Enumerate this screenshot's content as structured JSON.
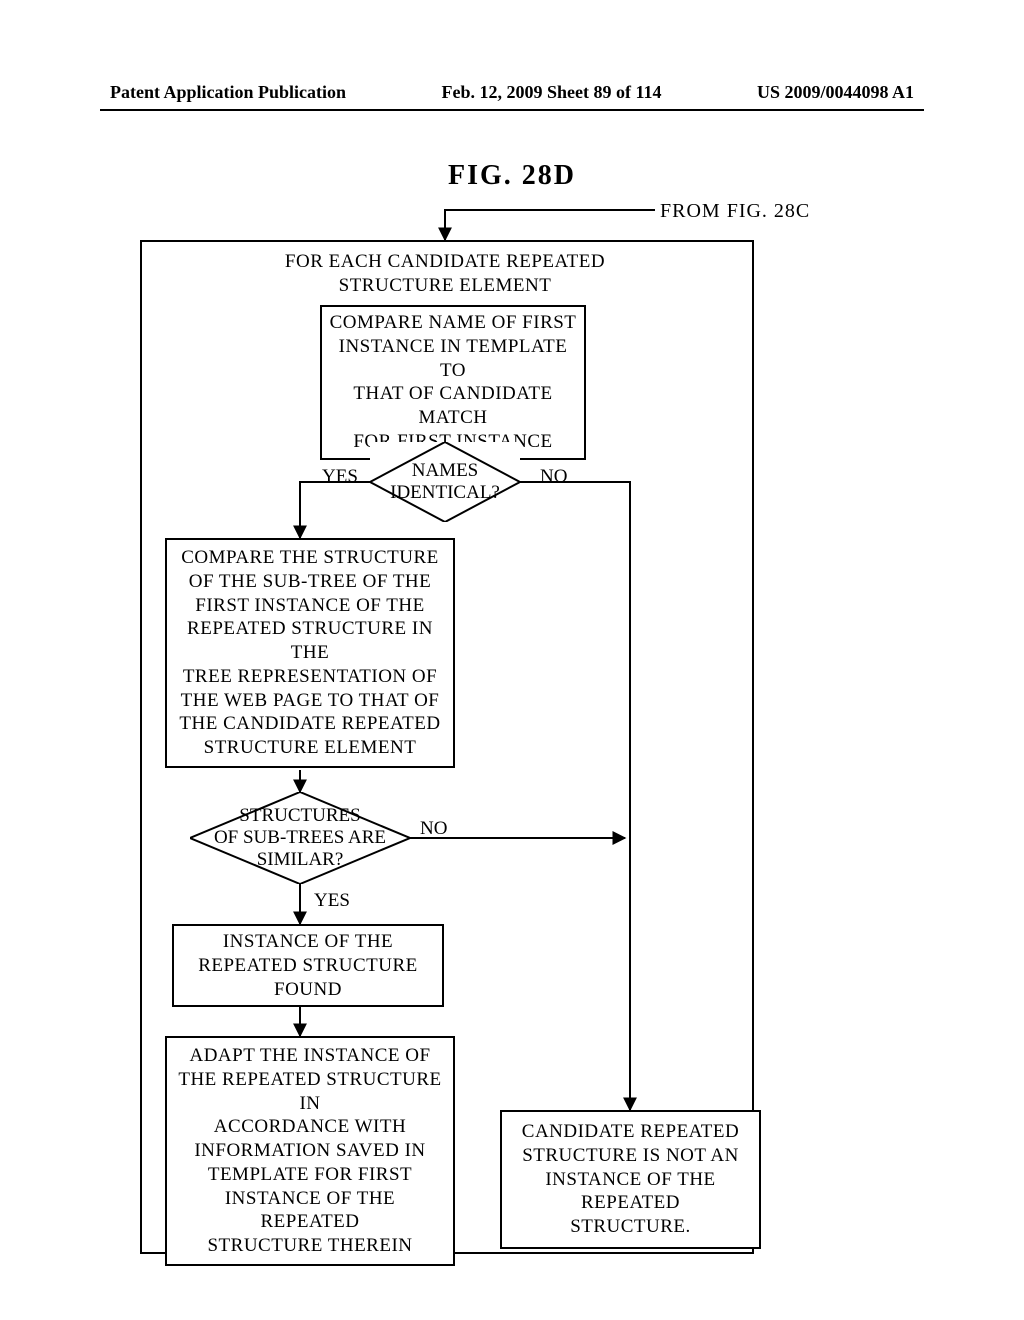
{
  "header": {
    "left": "Patent Application Publication",
    "center": "Feb. 12, 2009  Sheet 89 of 114",
    "right": "US 2009/0044098 A1"
  },
  "fig_title": "FIG. 28D",
  "from_label": "FROM FIG. 28C",
  "loop_header": "FOR EACH CANDIDATE REPEATED\nSTRUCTURE ELEMENT",
  "box_compare_name": "COMPARE NAME OF FIRST\nINSTANCE IN TEMPLATE TO\nTHAT OF CANDIDATE MATCH\nFOR FIRST INSTANCE",
  "diamond_names": "NAMES\nIDENTICAL?",
  "yes1": "YES",
  "no1": "NO",
  "box_compare_struct": "COMPARE THE STRUCTURE\nOF THE SUB-TREE OF THE\nFIRST INSTANCE OF THE\nREPEATED STRUCTURE IN THE\nTREE REPRESENTATION OF\nTHE WEB PAGE TO THAT OF\nTHE CANDIDATE REPEATED\nSTRUCTURE ELEMENT",
  "diamond_struct": "STRUCTURES\nOF SUB-TREES ARE\nSIMILAR?",
  "no2": "NO",
  "yes2": "YES",
  "box_found": "INSTANCE OF THE\nREPEATED STRUCTURE FOUND",
  "box_adapt": "ADAPT THE INSTANCE OF\nTHE REPEATED STRUCTURE IN\nACCORDANCE WITH\nINFORMATION SAVED IN\nTEMPLATE FOR FIRST\nINSTANCE OF THE REPEATED\nSTRUCTURE THEREIN",
  "box_notinstance": "CANDIDATE REPEATED\nSTRUCTURE IS NOT AN\nINSTANCE OF THE REPEATED\nSTRUCTURE.",
  "chart_data": {
    "type": "flowchart",
    "title": "FIG. 28D",
    "entry": "FROM FIG. 28C",
    "nodes": [
      {
        "id": "loop",
        "type": "loop-start",
        "text": "FOR EACH CANDIDATE REPEATED STRUCTURE ELEMENT"
      },
      {
        "id": "cmp_name",
        "type": "process",
        "text": "COMPARE NAME OF FIRST INSTANCE IN TEMPLATE TO THAT OF CANDIDATE MATCH FOR FIRST INSTANCE"
      },
      {
        "id": "d_names",
        "type": "decision",
        "text": "NAMES IDENTICAL?"
      },
      {
        "id": "cmp_struct",
        "type": "process",
        "text": "COMPARE THE STRUCTURE OF THE SUB-TREE OF THE FIRST INSTANCE OF THE REPEATED STRUCTURE IN THE TREE REPRESENTATION OF THE WEB PAGE TO THAT OF THE CANDIDATE REPEATED STRUCTURE ELEMENT"
      },
      {
        "id": "d_struct",
        "type": "decision",
        "text": "STRUCTURES OF SUB-TREES ARE SIMILAR?"
      },
      {
        "id": "found",
        "type": "process",
        "text": "INSTANCE OF THE REPEATED STRUCTURE FOUND"
      },
      {
        "id": "adapt",
        "type": "process",
        "text": "ADAPT THE INSTANCE OF THE REPEATED STRUCTURE IN ACCORDANCE WITH INFORMATION SAVED IN TEMPLATE FOR FIRST INSTANCE OF THE REPEATED STRUCTURE THEREIN"
      },
      {
        "id": "not_inst",
        "type": "process",
        "text": "CANDIDATE REPEATED STRUCTURE IS NOT AN INSTANCE OF THE REPEATED STRUCTURE."
      }
    ],
    "edges": [
      {
        "from": "entry",
        "to": "loop"
      },
      {
        "from": "loop",
        "to": "cmp_name"
      },
      {
        "from": "cmp_name",
        "to": "d_names"
      },
      {
        "from": "d_names",
        "to": "cmp_struct",
        "label": "YES"
      },
      {
        "from": "d_names",
        "to": "not_inst",
        "label": "NO"
      },
      {
        "from": "cmp_struct",
        "to": "d_struct"
      },
      {
        "from": "d_struct",
        "to": "found",
        "label": "YES"
      },
      {
        "from": "d_struct",
        "to": "not_inst",
        "label": "NO"
      },
      {
        "from": "found",
        "to": "adapt"
      }
    ]
  }
}
